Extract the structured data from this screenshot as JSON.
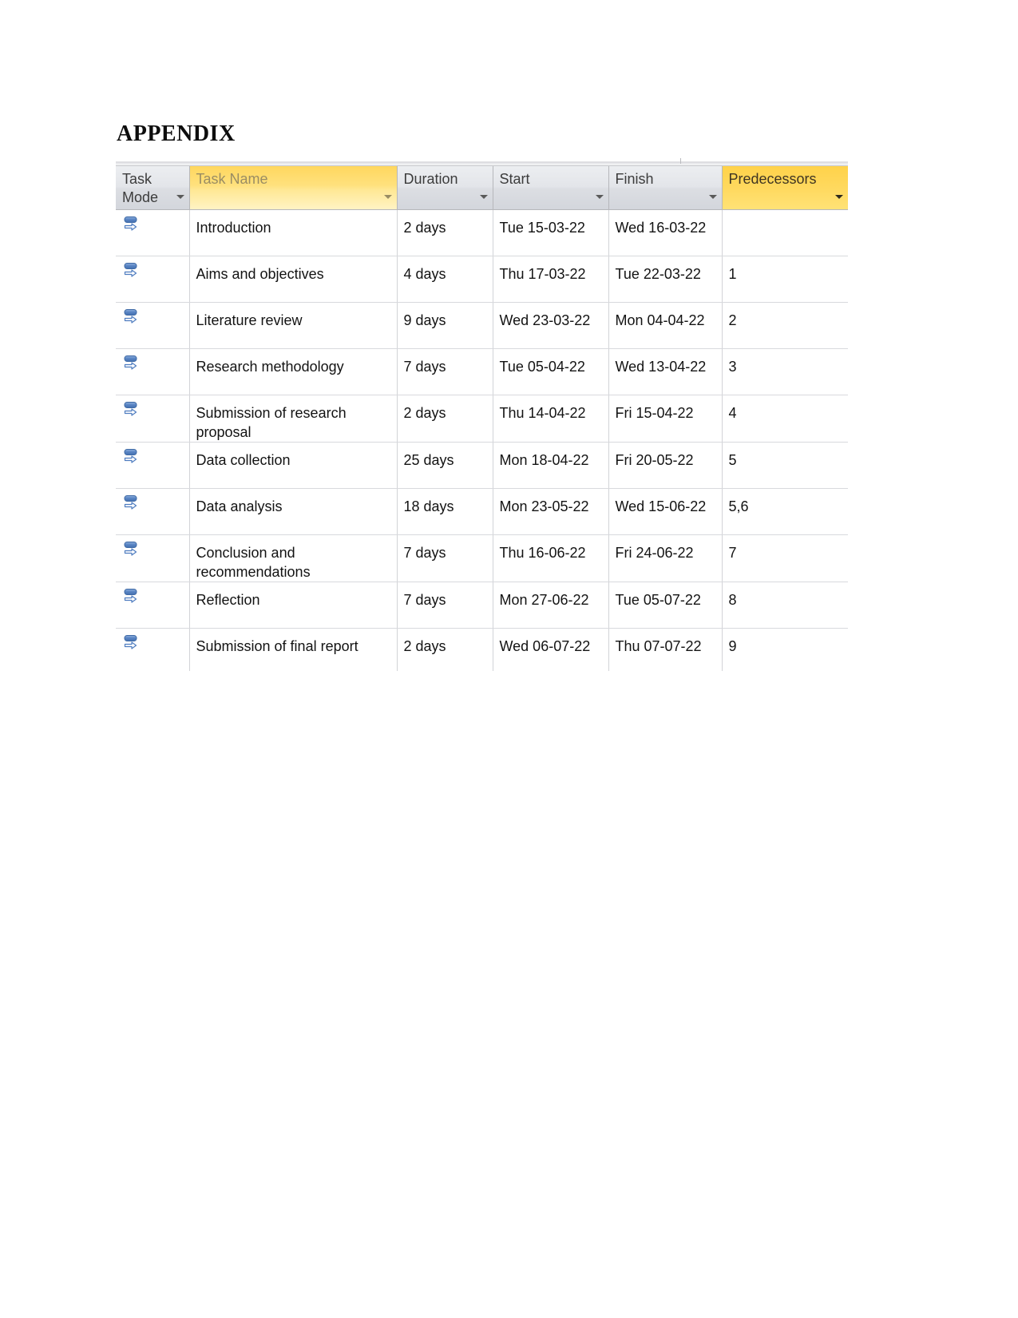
{
  "document": {
    "heading": "APPENDIX"
  },
  "grid": {
    "columns": [
      {
        "key": "task_mode",
        "label": "Task Mode",
        "style": "normal",
        "has_caret": true
      },
      {
        "key": "task_name",
        "label": "Task Name",
        "style": "highlight",
        "has_caret": true
      },
      {
        "key": "duration",
        "label": "Duration",
        "style": "normal",
        "has_caret": true
      },
      {
        "key": "start",
        "label": "Start",
        "style": "normal",
        "has_caret": true
      },
      {
        "key": "finish",
        "label": "Finish",
        "style": "normal",
        "has_caret": true
      },
      {
        "key": "predecessors",
        "label": "Predecessors",
        "style": "highlight-solid",
        "has_caret": true
      }
    ],
    "mode_icon": "auto-scheduled-icon",
    "colors": {
      "header_gold": "#ffd75e",
      "header_gold_solid": "#ffd24a",
      "header_gray": "#e3e5e9",
      "grid_line": "#d8d9dd",
      "icon_blue": "#4f7dc0",
      "text": "#131313"
    },
    "rows": [
      {
        "task_name": "Introduction",
        "duration": "2 days",
        "start": "Tue 15-03-22",
        "finish": "Wed 16-03-22",
        "predecessors": ""
      },
      {
        "task_name": "Aims and objectives",
        "duration": "4 days",
        "start": "Thu 17-03-22",
        "finish": "Tue 22-03-22",
        "predecessors": "1"
      },
      {
        "task_name": "Literature review",
        "duration": "9 days",
        "start": "Wed 23-03-22",
        "finish": "Mon 04-04-22",
        "predecessors": "2"
      },
      {
        "task_name": "Research methodology",
        "duration": "7 days",
        "start": "Tue 05-04-22",
        "finish": "Wed 13-04-22",
        "predecessors": "3"
      },
      {
        "task_name": "Submission of research proposal",
        "duration": "2 days",
        "start": "Thu 14-04-22",
        "finish": "Fri 15-04-22",
        "predecessors": "4"
      },
      {
        "task_name": "Data collection",
        "duration": "25 days",
        "start": "Mon 18-04-22",
        "finish": "Fri 20-05-22",
        "predecessors": "5"
      },
      {
        "task_name": "Data analysis",
        "duration": "18 days",
        "start": "Mon 23-05-22",
        "finish": "Wed 15-06-22",
        "predecessors": "5,6"
      },
      {
        "task_name": "Conclusion and recommendations",
        "duration": "7 days",
        "start": "Thu 16-06-22",
        "finish": "Fri 24-06-22",
        "predecessors": "7"
      },
      {
        "task_name": "Reflection",
        "duration": "7 days",
        "start": "Mon 27-06-22",
        "finish": "Tue 05-07-22",
        "predecessors": "8"
      },
      {
        "task_name": "Submission of final report",
        "duration": "2 days",
        "start": "Wed 06-07-22",
        "finish": "Thu 07-07-22",
        "predecessors": "9"
      }
    ]
  }
}
